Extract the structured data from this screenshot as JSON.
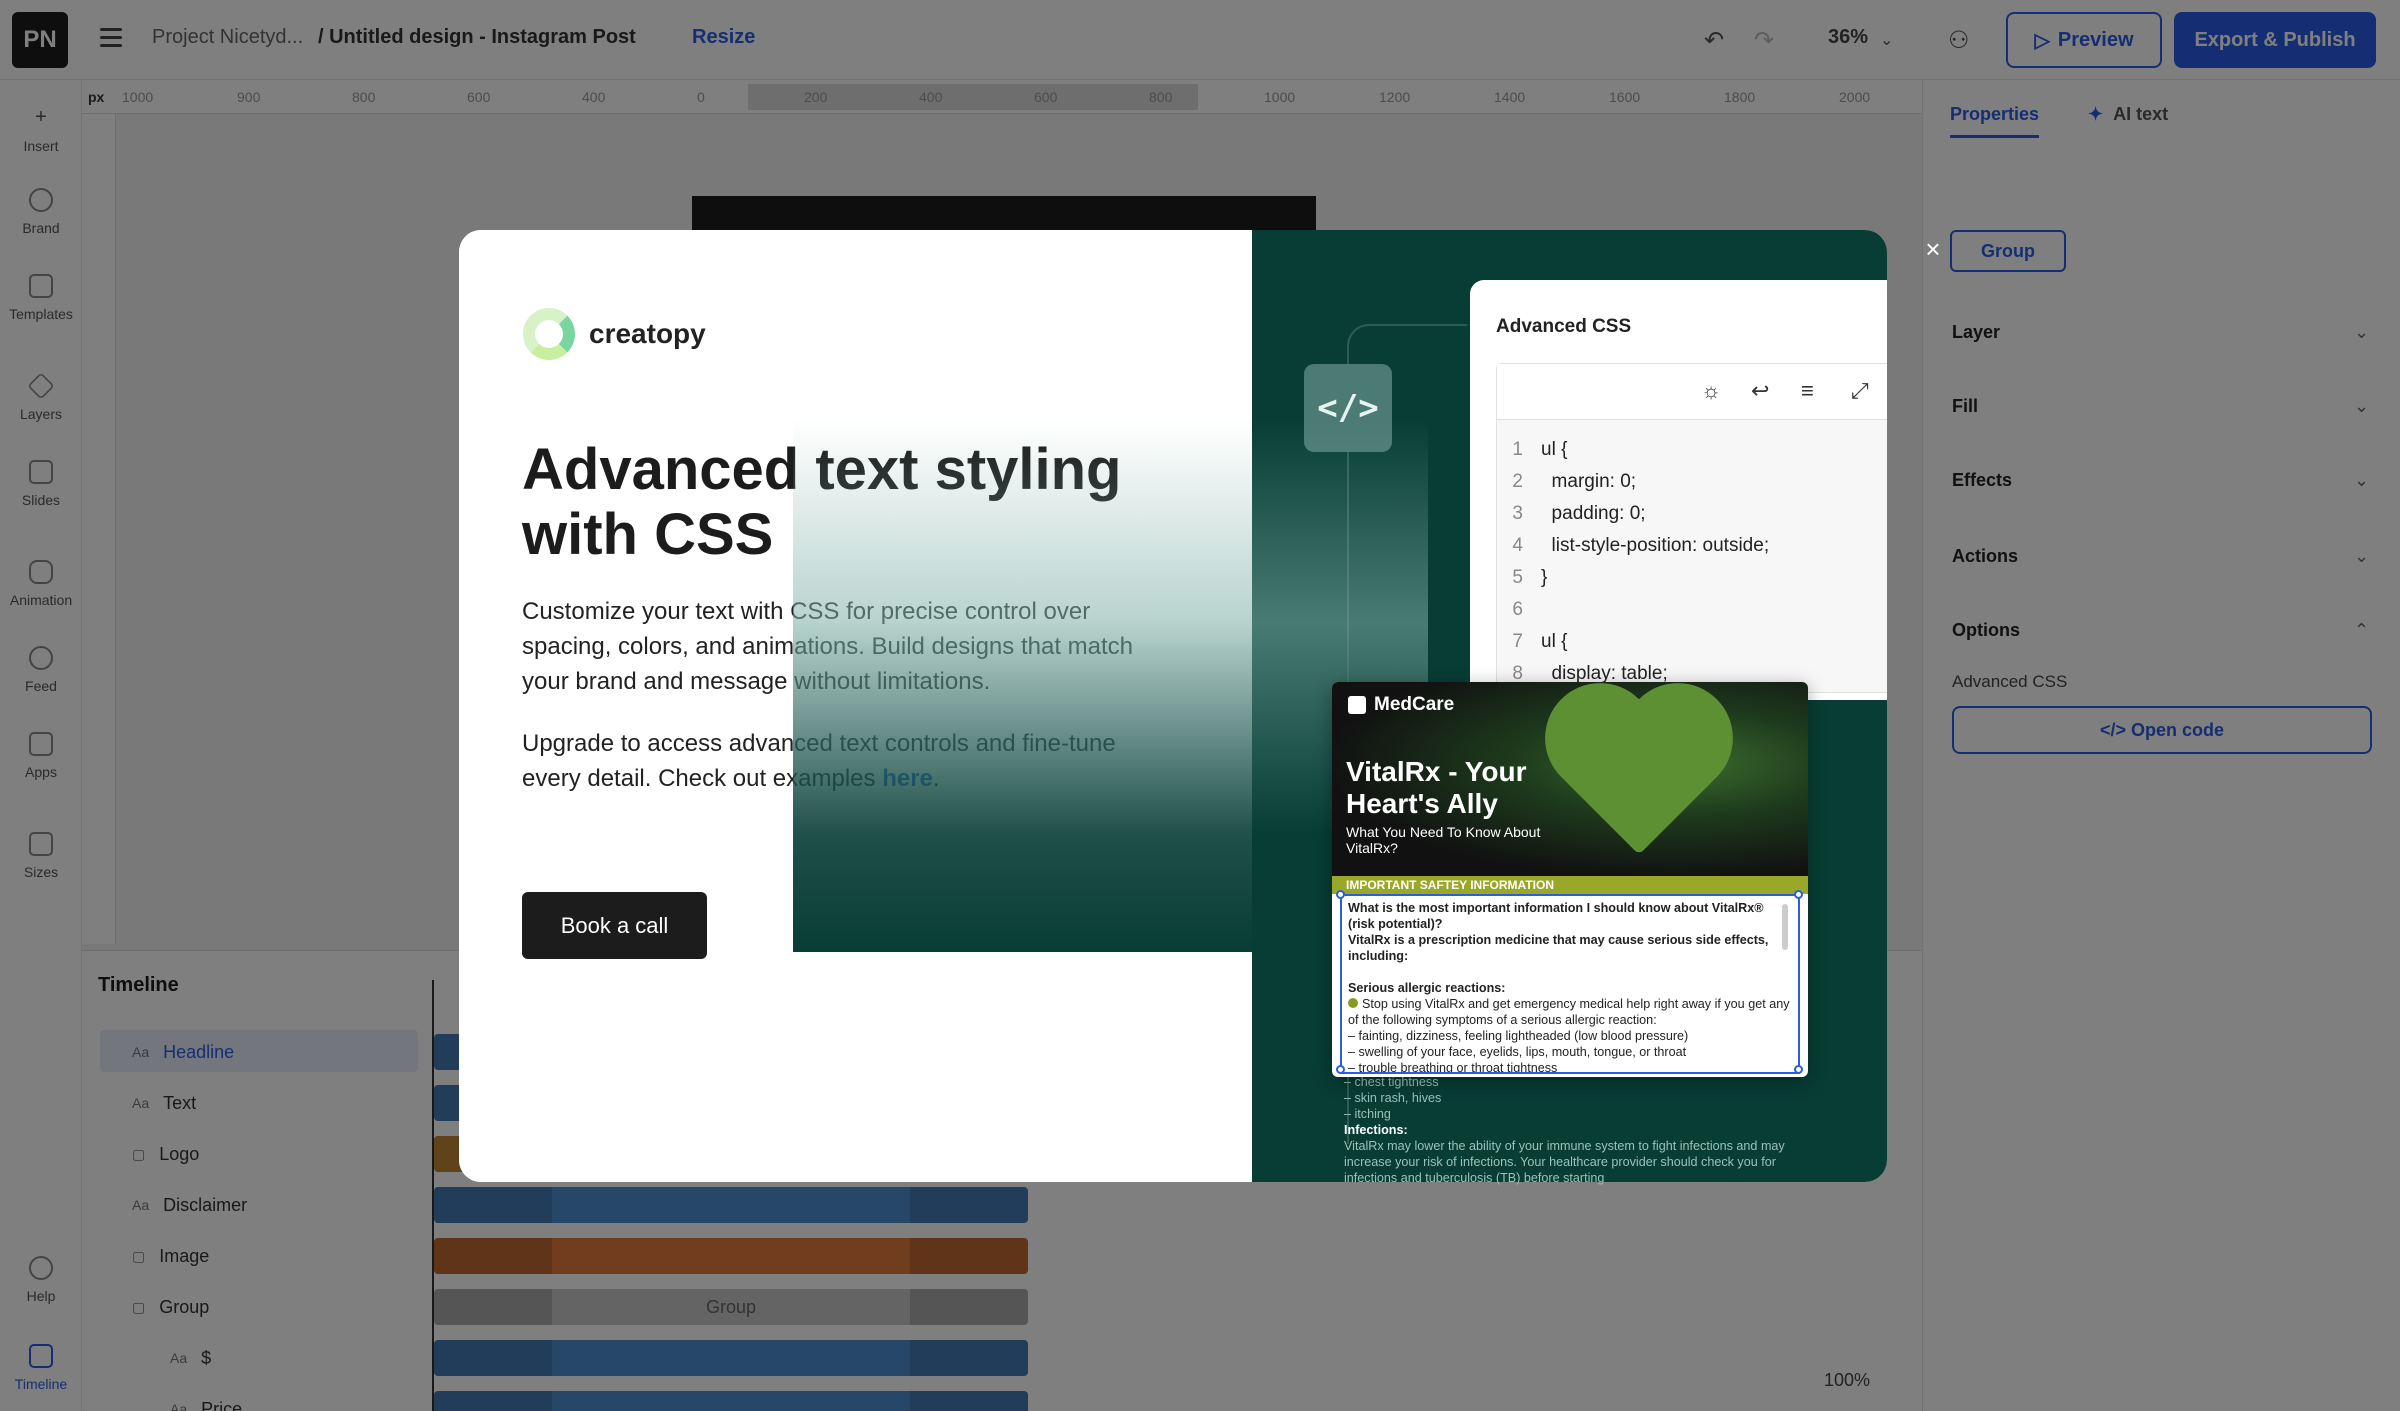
{
  "app": {
    "logo": "PN",
    "breadcrumb_project": "Project Nicetyd...",
    "breadcrumb_design": "/ Untitled design - Instagram Post",
    "resize_label": "Resize",
    "zoom": "36%",
    "preview_label": "Preview",
    "export_label": "Export & Publish"
  },
  "left_tools": [
    {
      "label": "Insert"
    },
    {
      "label": "Brand"
    },
    {
      "label": "Templates"
    },
    {
      "label": "Layers"
    },
    {
      "label": "Slides"
    },
    {
      "label": "Animation"
    },
    {
      "label": "Feed"
    },
    {
      "label": "Apps"
    },
    {
      "label": "Sizes"
    },
    {
      "label": "Help"
    },
    {
      "label": "Timeline"
    }
  ],
  "ruler": {
    "unit": "px",
    "ticks": [
      "1000",
      "900",
      "800",
      "600",
      "400",
      "0",
      "200",
      "400",
      "600",
      "800",
      "1000",
      "1200",
      "1400",
      "1600",
      "1800",
      "2000"
    ]
  },
  "right_panel": {
    "tab_properties": "Properties",
    "tab_ai": "AI text",
    "group_label": "Group",
    "sections": [
      "Layer",
      "Fill",
      "Effects",
      "Actions",
      "Options"
    ],
    "advanced_css_label": "Advanced CSS",
    "open_code_label": "</> Open code"
  },
  "timeline": {
    "title": "Timeline",
    "rows": [
      {
        "label": "Headline",
        "icon": "Aa",
        "color": "#4f8ed1"
      },
      {
        "label": "Text",
        "icon": "Aa",
        "color": "#4f8ed1"
      },
      {
        "label": "Logo",
        "icon": "▢",
        "color": "#e0a03c"
      },
      {
        "label": "Disclaimer",
        "icon": "Aa",
        "color": "#4f8ed1"
      },
      {
        "label": "Image",
        "icon": "▢",
        "color": "#e07b3c"
      },
      {
        "label": "Group",
        "icon": "▢",
        "color": "#c8c8c8"
      },
      {
        "label": "$",
        "icon": "Aa",
        "color": "#4f8ed1"
      },
      {
        "label": "Price",
        "icon": "Aa",
        "color": "#4f8ed1"
      }
    ],
    "group_bar_label": "Group",
    "zoom_label": "100%"
  },
  "modal": {
    "brand_name": "creatopy",
    "title": "Advanced text styling with CSS",
    "paragraph1": "Customize your text with CSS for precise control over spacing, colors, and animations. Build designs that match your brand and message without limitations.",
    "paragraph2_prefix": "Upgrade to access advanced text controls and fine-tune every detail. Check out examples ",
    "paragraph2_link": "here",
    "paragraph2_suffix": ".",
    "cta_label": "Book a call",
    "close_label": "×",
    "code_badge": "</>",
    "css_panel_title": "Advanced CSS",
    "code_lines": [
      {
        "n": "1",
        "text": "ul {"
      },
      {
        "n": "2",
        "text": "  margin: 0;"
      },
      {
        "n": "3",
        "text": "  padding: 0;"
      },
      {
        "n": "4",
        "text": "  list-style-position: outside;"
      },
      {
        "n": "5",
        "text": "}"
      },
      {
        "n": "6",
        "text": ""
      },
      {
        "n": "7",
        "text": "ul {"
      },
      {
        "n": "8",
        "text": "  display: table;"
      }
    ],
    "ad": {
      "logo": "MedCare",
      "headline": "VitalRx - Your Heart's Ally",
      "subheadline": "What You Need To Know About VitalRx?",
      "band": "IMPORTANT SAFTEY INFORMATION",
      "q1": "What is the most important information I should know about VitalRx® (risk potential)?",
      "q2": "VitalRx is a prescription medicine that may cause serious side effects, including:",
      "allergic_title": "Serious allergic reactions:",
      "allergic_text": "Stop using VitalRx and get emergency medical help right away if you get any of the following symptoms of a serious allergic reaction:",
      "symptoms": [
        "– fainting, dizziness, feeling lightheaded (low blood pressure)",
        "– swelling of your face, eyelids, lips, mouth, tongue, or throat",
        "– trouble breathing or throat tightness"
      ],
      "overflow_lines": [
        "– chest tightness",
        "– skin rash, hives",
        "–  itching"
      ],
      "infections_title": "Infections:",
      "infections_text": "VitalRx may lower the ability of your immune system to fight infections and may increase your risk of infections. Your healthcare provider should check you for infections and tuberculosis (TB) before starting"
    }
  }
}
